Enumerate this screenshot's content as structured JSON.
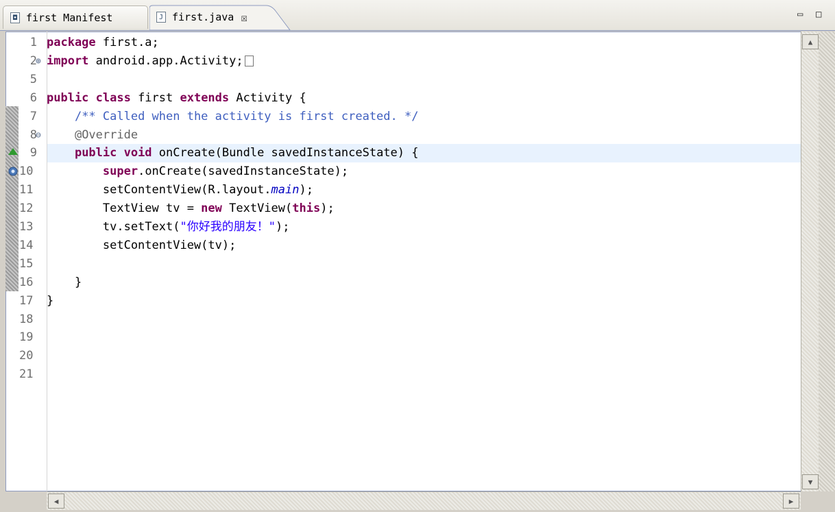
{
  "tabs": [
    {
      "label": "first Manifest",
      "icon": "android-manifest-icon",
      "active": false
    },
    {
      "label": "first.java",
      "icon": "java-file-icon",
      "active": true,
      "close": "☒"
    }
  ],
  "window_controls": {
    "minimize": "▭",
    "maximize": "□"
  },
  "editor": {
    "lines": [
      {
        "num": "1",
        "html": "<span class='kw'>package</span> first.a;"
      },
      {
        "num": "2",
        "fold": "⊕",
        "html": "<span class='kw'>import</span> android.app.Activity;"
      },
      {
        "num": "5",
        "html": ""
      },
      {
        "num": "6",
        "html": "<span class='kw'>public class</span> first <span class='kw'>extends</span> Activity {"
      },
      {
        "num": "7",
        "html": "    <span class='cm'>/** Called when the activity is first created. */</span>"
      },
      {
        "num": "8",
        "fold": "⊖",
        "html": "    <span class='an'>@Override</span>"
      },
      {
        "num": "9",
        "html": "    <span class='kw'>public void</span> onCreate(Bundle savedInstanceState) {"
      },
      {
        "num": "10",
        "html": "        <span class='kw'>super</span>.onCreate(savedInstanceState);"
      },
      {
        "num": "11",
        "html": "        setContentView(R.layout.<span class='it'>main</span>);"
      },
      {
        "num": "12",
        "html": "        TextView tv = <span class='kw'>new</span> TextView(<span class='kw'>this</span>);"
      },
      {
        "num": "13",
        "html": "        tv.setText(<span class='st'>\"你好我的朋友！\"</span>);"
      },
      {
        "num": "14",
        "html": "        setContentView(tv);"
      },
      {
        "num": "15",
        "html": ""
      },
      {
        "num": "16",
        "html": "    }"
      },
      {
        "num": "17",
        "html": "}"
      },
      {
        "num": "18",
        "html": ""
      },
      {
        "num": "19",
        "html": ""
      },
      {
        "num": "20",
        "html": ""
      },
      {
        "num": "21",
        "html": ""
      }
    ]
  }
}
